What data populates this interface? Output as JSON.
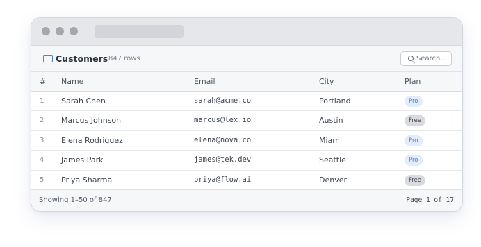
{
  "window": {
    "controls": [
      "dot",
      "dot",
      "dot"
    ]
  },
  "header": {
    "title": "Customers",
    "row_count": "847 rows",
    "icon": "table-icon",
    "search": {
      "placeholder": "Search...",
      "icon": "search-icon"
    }
  },
  "table": {
    "columns": [
      "#",
      "Name",
      "Email",
      "City",
      "Plan"
    ],
    "rows": [
      {
        "index": "1",
        "name": "Sarah Chen",
        "email": "sarah@acme.co",
        "city": "Portland",
        "plan": "Pro"
      },
      {
        "index": "2",
        "name": "Marcus Johnson",
        "email": "marcus@lex.io",
        "city": "Austin",
        "plan": "Free"
      },
      {
        "index": "3",
        "name": "Elena Rodriguez",
        "email": "elena@nova.co",
        "city": "Miami",
        "plan": "Pro"
      },
      {
        "index": "4",
        "name": "James Park",
        "email": "james@tek.dev",
        "city": "Seattle",
        "plan": "Pro"
      },
      {
        "index": "5",
        "name": "Priya Sharma",
        "email": "priya@flow.ai",
        "city": "Denver",
        "plan": "Free"
      }
    ]
  },
  "footer": {
    "showing": "Showing 1–50 of 847",
    "pagination": "Page 1 of 17"
  },
  "colors": {
    "accent": "#4a7fd8",
    "pro_badge_bg": "#e3ecfb",
    "pro_badge_text": "#4b7fd6",
    "free_badge_bg": "#d9dade",
    "free_badge_text": "#3f4650",
    "chrome_bg": "#e6e7ea"
  }
}
